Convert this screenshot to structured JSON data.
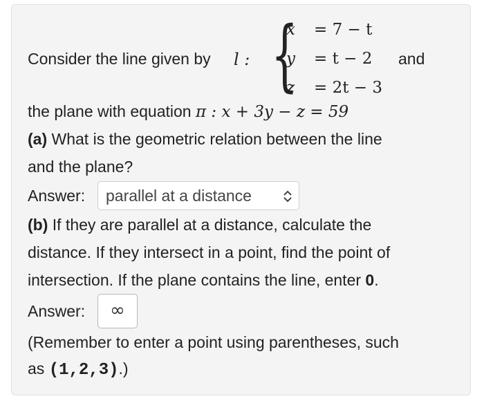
{
  "intro": {
    "text": "Consider the line given by",
    "line_label": "l :",
    "line_equations": [
      {
        "var": "x",
        "eq": "= 7 − t"
      },
      {
        "var": "y",
        "eq": "= t − 2"
      },
      {
        "var": "z",
        "eq": "= 2t − 3"
      }
    ],
    "and": "and",
    "plane_text": "the plane with equation",
    "plane_equation": "π : x + 3y − z = 59"
  },
  "part_a": {
    "label": "(a)",
    "question_line1": "What is the geometric relation between the line",
    "question_line2": "and the plane?",
    "answer_label": "Answer:",
    "selected_value": "parallel at a distance",
    "select_icon": "up-down-chevron-icon"
  },
  "part_b": {
    "label": "(b)",
    "question_line1": "If they are parallel at a distance, calculate the",
    "question_line2": "distance. If they intersect in a point, find the point of",
    "question_line3_prefix": "intersection. If the plane contains the line, enter",
    "question_line3_zero": "0",
    "question_line3_suffix": ".",
    "answer_label": "Answer:",
    "answer_value": "∞"
  },
  "reminder": {
    "line1": "(Remember to enter a point using parentheses, such",
    "line2_prefix": "as",
    "line2_code": "(1,2,3)",
    "line2_suffix": ".)"
  }
}
